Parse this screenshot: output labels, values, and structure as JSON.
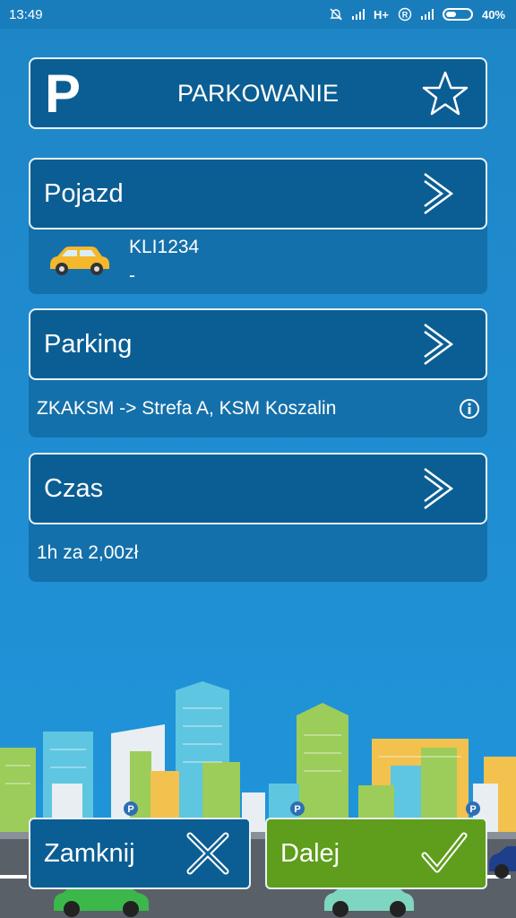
{
  "status_bar": {
    "time": "13:49",
    "network": "H+",
    "battery": "40%"
  },
  "header": {
    "logo_letter": "P",
    "title": "PARKOWANIE"
  },
  "vehicle": {
    "label": "Pojazd",
    "plate": "KLI1234",
    "description": "-"
  },
  "parking": {
    "label": "Parking",
    "zone": "ZKAKSM -> Strefa A, KSM Koszalin"
  },
  "time": {
    "label": "Czas",
    "price": "1h za 2,00zł"
  },
  "buttons": {
    "close": "Zamknij",
    "next": "Dalej"
  },
  "colors": {
    "panel": "#0b5e93",
    "card_body": "#1470aa",
    "next_button": "#5e9e1c",
    "background": "#1f8cd0"
  },
  "icons": [
    "star-icon",
    "chevron-right-icon",
    "car-icon",
    "info-icon",
    "close-x-icon",
    "check-icon"
  ]
}
